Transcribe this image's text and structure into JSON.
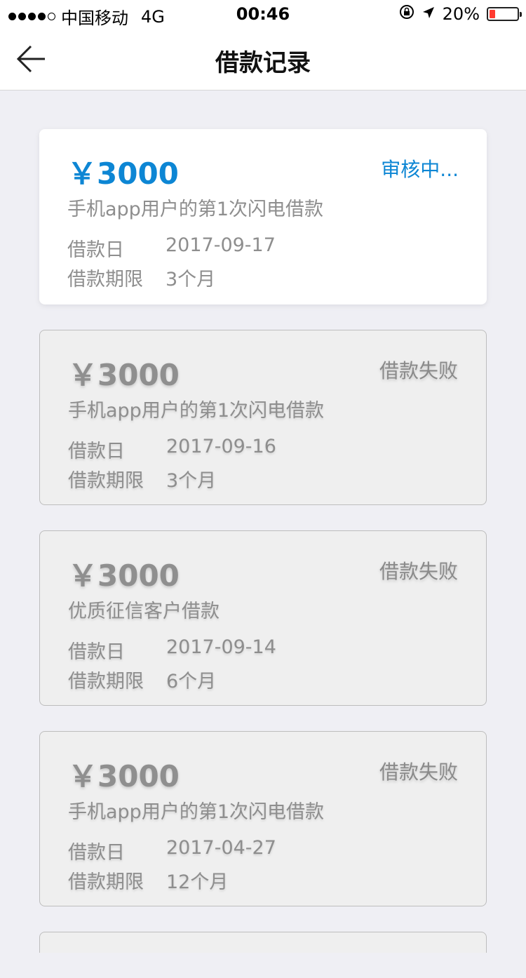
{
  "status_bar": {
    "carrier": "中国移动",
    "network": "4G",
    "time": "00:46",
    "battery_text": "20%",
    "battery_level": 0.2,
    "battery_color": "#ff3b30"
  },
  "nav": {
    "title": "借款记录",
    "back_icon": "back-arrow-icon"
  },
  "colors": {
    "accent": "#0d86d4",
    "muted": "#8e8e8e"
  },
  "loans": [
    {
      "amount": "￥3000",
      "status": "审核中...",
      "description": "手机app用户的第1次闪电借款",
      "date_label": "借款日",
      "date": "2017-09-17",
      "term_label": "借款期限",
      "term": "3个月"
    },
    {
      "amount": "￥3000",
      "status": "借款失败",
      "description": "手机app用户的第1次闪电借款",
      "date_label": "借款日",
      "date": "2017-09-16",
      "term_label": "借款期限",
      "term": "3个月"
    },
    {
      "amount": "￥3000",
      "status": "借款失败",
      "description": "优质征信客户借款",
      "date_label": "借款日",
      "date": "2017-09-14",
      "term_label": "借款期限",
      "term": "6个月"
    },
    {
      "amount": "￥3000",
      "status": "借款失败",
      "description": "手机app用户的第1次闪电借款",
      "date_label": "借款日",
      "date": "2017-04-27",
      "term_label": "借款期限",
      "term": "12个月"
    }
  ]
}
